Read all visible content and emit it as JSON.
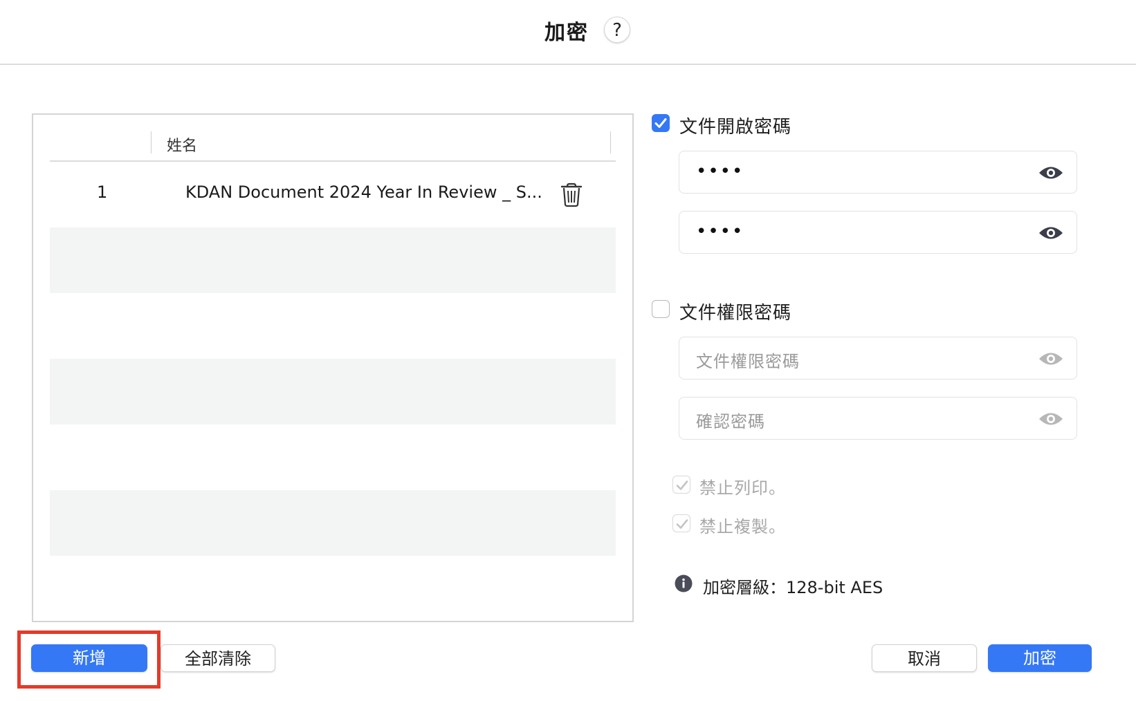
{
  "dialog": {
    "title": "加密",
    "help_label": "?"
  },
  "file_list": {
    "column_name_header": "姓名",
    "rows": [
      {
        "index": "1",
        "name": "KDAN Document 2024 Year In Review _ S..."
      }
    ]
  },
  "open_password": {
    "checked": true,
    "label": "文件開啟密碼",
    "password_value": "••••",
    "confirm_value": "••••"
  },
  "permission_password": {
    "checked": false,
    "label": "文件權限密碼",
    "password_placeholder": "文件權限密碼",
    "confirm_placeholder": "確認密碼",
    "options": [
      {
        "label": "禁止列印。",
        "checked": true,
        "enabled": false
      },
      {
        "label": "禁止複製。",
        "checked": true,
        "enabled": false
      }
    ]
  },
  "encryption_level": "加密層級：128-bit AES",
  "buttons": {
    "add": "新增",
    "clear_all": "全部清除",
    "cancel": "取消",
    "encrypt": "加密"
  },
  "colors": {
    "accent": "#3478f6",
    "highlight": "#e23b2a"
  }
}
